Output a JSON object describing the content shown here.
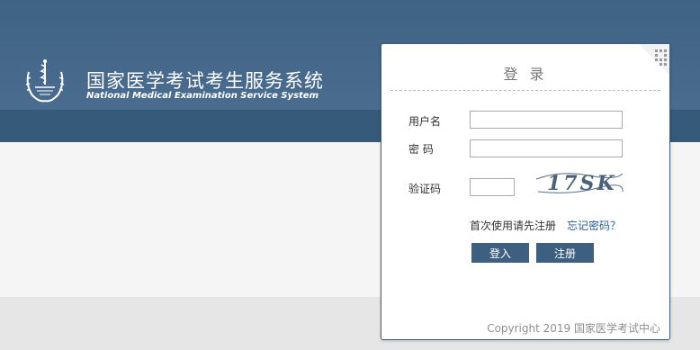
{
  "header": {
    "title": "国家医学考试考生服务系统",
    "subtitle": "National Medical Examination Service System",
    "logo_icon": "medical-caduceus-emblem-icon"
  },
  "login": {
    "title": "登 录",
    "username_label": "用户名",
    "username_value": "",
    "password_label": "密 码",
    "password_value": "",
    "captcha_label": "验证码",
    "captcha_value": "",
    "captcha_image_text": "17SK",
    "register_hint": "首次使用请先注册",
    "forgot_password": "忘记密码？",
    "login_button": "登入",
    "register_button": "注册",
    "qr_icon": "qr-code-icon"
  },
  "footer": {
    "copyright": "Copyright 2019 国家医学考试中心"
  },
  "colors": {
    "banner": "#456a8c",
    "banner_strip": "#355a7a",
    "button": "#3d5f80",
    "link": "#2a5a96"
  }
}
